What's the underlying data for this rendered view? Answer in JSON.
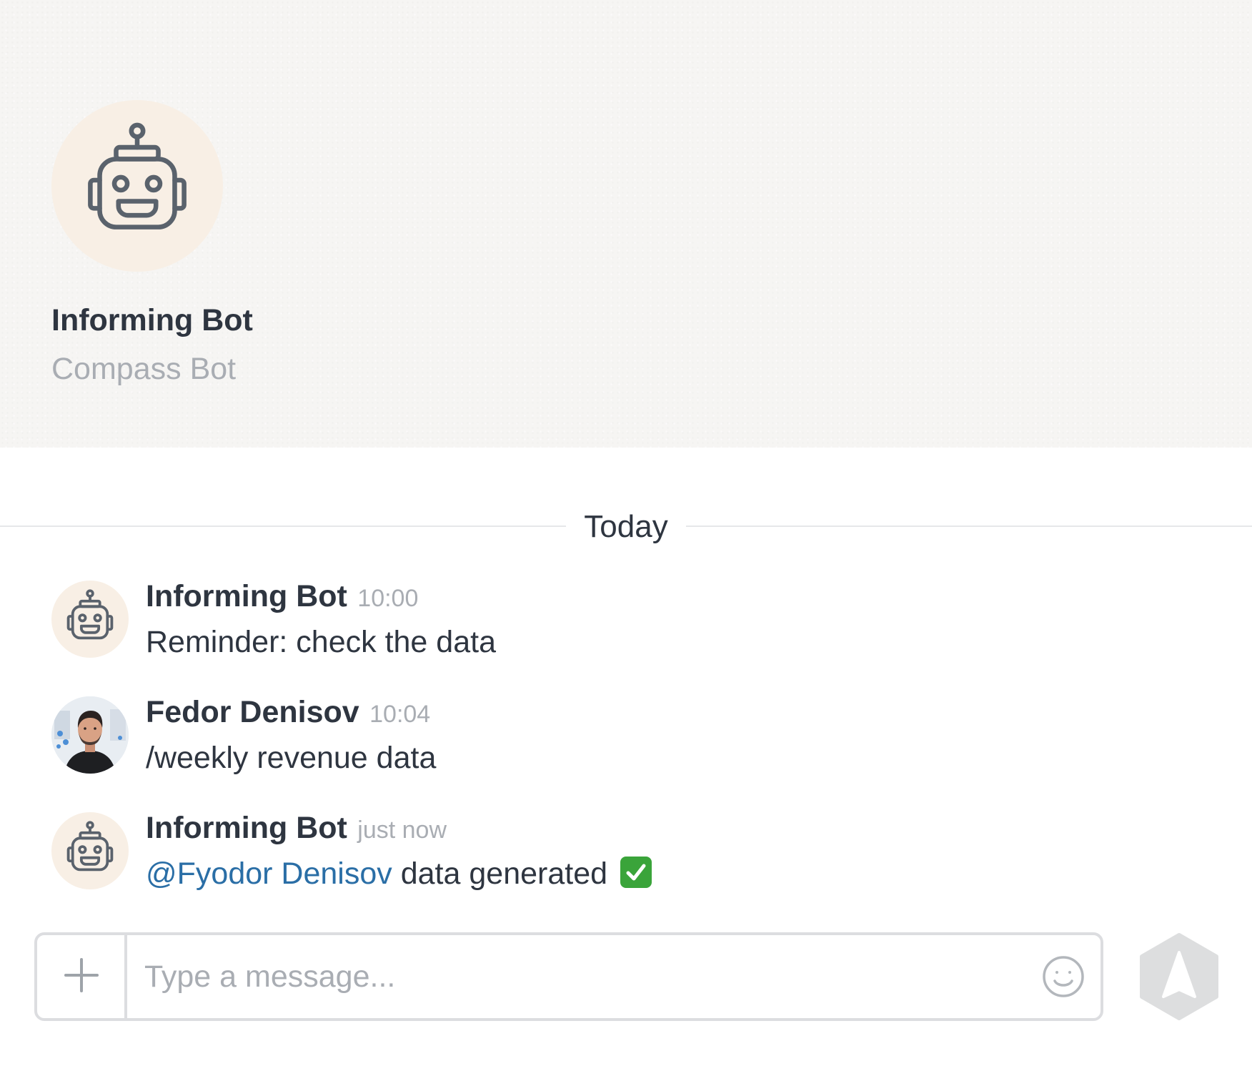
{
  "header": {
    "bot_name": "Informing Bot",
    "bot_subtitle": "Compass Bot"
  },
  "divider": {
    "label": "Today"
  },
  "messages": [
    {
      "author": "Informing Bot",
      "time": "10:00",
      "text": "Reminder: check the data",
      "avatar": "robot-icon"
    },
    {
      "author": "Fedor Denisov",
      "time": "10:04",
      "text": "/weekly revenue data",
      "avatar": "user-photo"
    },
    {
      "author": "Informing Bot",
      "time": "just now",
      "mention": "@Fyodor Denisov",
      "text": " data generated ",
      "emoji": "white-check-mark",
      "avatar": "robot-icon"
    }
  ],
  "composer": {
    "placeholder": "Type a message...",
    "add_icon": "plus-icon",
    "emoji_icon": "smiley-icon",
    "send_icon": "send-arrow-icon"
  },
  "colors": {
    "accent_mention": "#2a6ea6",
    "avatar_bg": "#f8efe5",
    "check_green": "#3aa43a",
    "send_button": "#dddedf"
  }
}
